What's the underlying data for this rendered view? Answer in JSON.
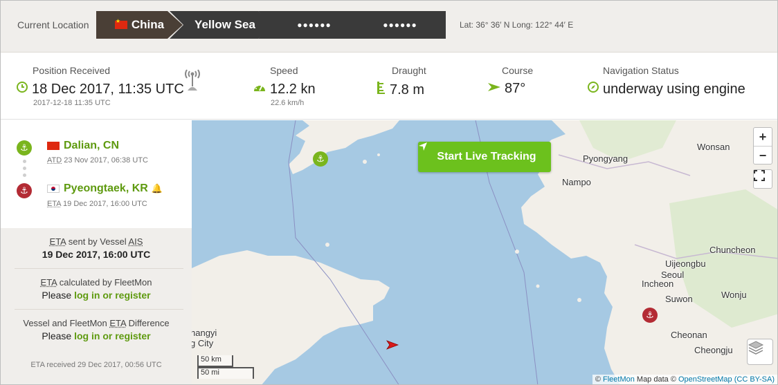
{
  "location": {
    "label": "Current Location",
    "crumbs": [
      "China",
      "Yellow Sea",
      "●●●●●●",
      "●●●●●●"
    ],
    "coords": "Lat: 36° 36′ N   Long: 122° 44′ E"
  },
  "stats": {
    "position": {
      "label": "Position Received",
      "value": "18 Dec 2017, 11:35 UTC",
      "sub": "2017-12-18 11:35 UTC"
    },
    "speed": {
      "label": "Speed",
      "value": "12.2 kn",
      "sub": "22.6 km/h"
    },
    "draught": {
      "label": "Draught",
      "value": "7.8 m"
    },
    "course": {
      "label": "Course",
      "value": "87°"
    },
    "nav": {
      "label": "Navigation Status",
      "value": "underway using engine"
    }
  },
  "ports": {
    "departure": {
      "name": "Dalian, CN",
      "time_label": "ATD",
      "time": "23 Nov 2017, 06:38 UTC"
    },
    "arrival": {
      "name": "Pyeongtaek, KR",
      "time_label": "ETA",
      "time": "19 Dec 2017, 16:00 UTC"
    }
  },
  "eta": {
    "vessel_label_prefix": "ETA",
    "vessel_label_suffix": "sent by Vessel",
    "vessel_label_ais": "AIS",
    "vessel_value": "19 Dec 2017, 16:00 UTC",
    "fleetmon_label_prefix": "ETA",
    "fleetmon_label_suffix": "calculated by FleetMon",
    "please": "Please",
    "login_link": "log in or register",
    "diff_label_prefix": "Vessel and FleetMon",
    "diff_label_eta": "ETA",
    "diff_label_suffix": "Difference",
    "received": "ETA received 29 Dec 2017, 00:56 UTC"
  },
  "map": {
    "live_button": "Start Live Tracking",
    "zoom_in": "+",
    "zoom_out": "−",
    "labels": {
      "wonsan": "Wonsan",
      "pyongyang": "Pyongyang",
      "nampo": "Nampo",
      "chuncheon": "Chuncheon",
      "uijeongbu": "Uijeongbu",
      "seoul": "Seoul",
      "incheon": "Incheon",
      "suwon": "Suwon",
      "wonju": "Wonju",
      "cheonan": "Cheonan",
      "cheongju": "Cheongju",
      "hangyi": "hangyi",
      "city": "g City"
    },
    "scale_km": "50 km",
    "scale_mi": "50 mi",
    "attribution": {
      "copy1": "©",
      "fleetmon": "FleetMon",
      "mapdata": "Map data ©",
      "osm": "OpenStreetMap",
      "license": "(CC BY-SA)"
    }
  }
}
